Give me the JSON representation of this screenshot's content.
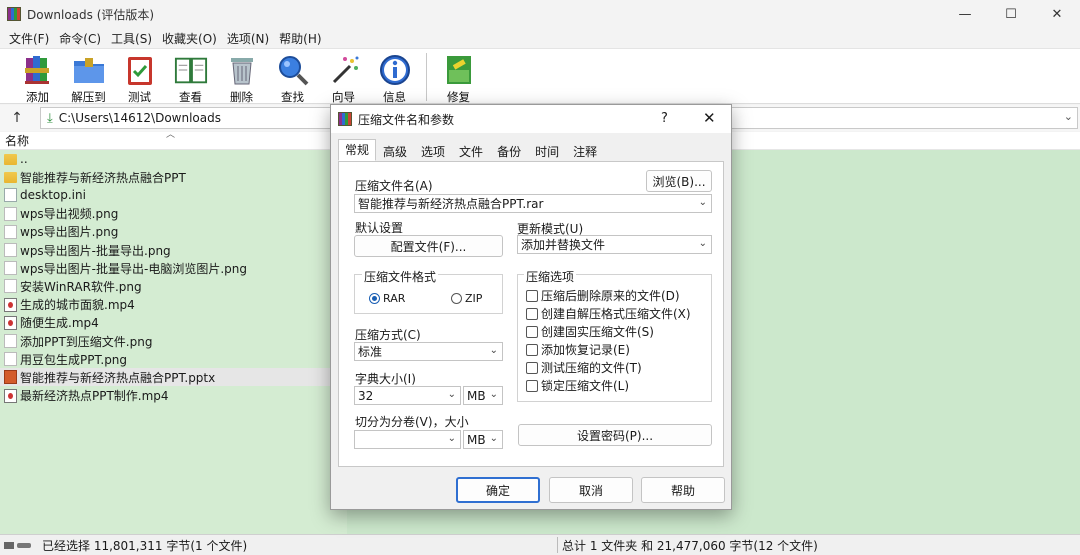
{
  "window": {
    "title": "Downloads (评估版本)",
    "controls": [
      "—",
      "☐",
      "✕"
    ]
  },
  "menu": [
    "文件(F)",
    "命令(C)",
    "工具(S)",
    "收藏夹(O)",
    "选项(N)",
    "帮助(H)"
  ],
  "toolbar": [
    {
      "label": "添加",
      "icon": "books-add-icon"
    },
    {
      "label": "解压到",
      "icon": "folder-extract-icon"
    },
    {
      "label": "测试",
      "icon": "clipboard-check-icon"
    },
    {
      "label": "查看",
      "icon": "book-view-icon"
    },
    {
      "label": "删除",
      "icon": "trash-icon"
    },
    {
      "label": "查找",
      "icon": "magnifier-icon"
    },
    {
      "label": "向导",
      "icon": "wand-icon"
    },
    {
      "label": "信息",
      "icon": "info-icon"
    },
    {
      "label": "修复",
      "icon": "repair-icon"
    }
  ],
  "address": {
    "path": "C:\\Users\\14612\\Downloads",
    "up": "↑"
  },
  "list": {
    "column_name": "名称",
    "files": [
      {
        "name": "..",
        "type": "folder"
      },
      {
        "name": "智能推荐与新经济热点融合PPT",
        "type": "folder"
      },
      {
        "name": "desktop.ini",
        "type": "file"
      },
      {
        "name": "wps导出视频.png",
        "type": "img"
      },
      {
        "name": "wps导出图片.png",
        "type": "img"
      },
      {
        "name": "wps导出图片-批量导出.png",
        "type": "img"
      },
      {
        "name": "wps导出图片-批量导出-电脑浏览图片.png",
        "type": "img"
      },
      {
        "name": "安装WinRAR软件.png",
        "type": "img"
      },
      {
        "name": "生成的城市面貌.mp4",
        "type": "vid"
      },
      {
        "name": "随便生成.mp4",
        "type": "vid"
      },
      {
        "name": "添加PPT到压缩文件.png",
        "type": "img"
      },
      {
        "name": "用豆包生成PPT.png",
        "type": "img"
      },
      {
        "name": "智能推荐与新经济热点融合PPT.pptx",
        "type": "ppt",
        "selected": true
      },
      {
        "name": "最新经济热点PPT制作.mp4",
        "type": "vid"
      }
    ]
  },
  "status": {
    "left": "已经选择 11,801,311 字节(1 个文件)",
    "right": "总计 1 文件夹 和 21,477,060 字节(12 个文件)"
  },
  "dialog": {
    "title": "压缩文件名和参数",
    "help": "?",
    "close": "✕",
    "tabs": [
      "常规",
      "高级",
      "选项",
      "文件",
      "备份",
      "时间",
      "注释"
    ],
    "archive_name_label": "压缩文件名(A)",
    "browse": "浏览(B)...",
    "archive_name": "智能推荐与新经济热点融合PPT.rar",
    "default_settings": "默认设置",
    "profiles": "配置文件(F)...",
    "update_mode_label": "更新模式(U)",
    "update_mode": "添加并替换文件",
    "format_label": "压缩文件格式",
    "format_rar": "RAR",
    "format_zip": "ZIP",
    "method_label": "压缩方式(C)",
    "method": "标准",
    "dict_label": "字典大小(I)",
    "dict_value": "32",
    "dict_unit": "MB",
    "split_label": "切分为分卷(V)，大小",
    "split_value": "",
    "split_unit": "MB",
    "options_label": "压缩选项",
    "options": [
      "压缩后删除原来的文件(D)",
      "创建自解压格式压缩文件(X)",
      "创建固实压缩文件(S)",
      "添加恢复记录(E)",
      "测试压缩的文件(T)",
      "锁定压缩文件(L)"
    ],
    "password": "设置密码(P)...",
    "ok": "确定",
    "cancel": "取消",
    "helpbtn": "帮助"
  }
}
